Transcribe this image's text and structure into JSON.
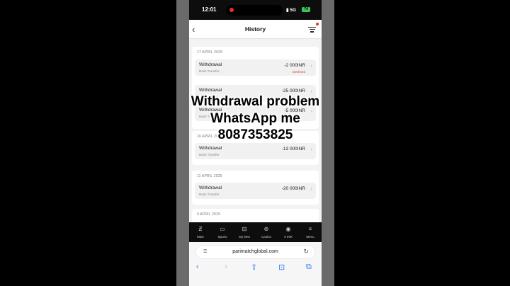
{
  "status_bar": {
    "time": "12:01",
    "network": "5G",
    "battery": "74"
  },
  "header": {
    "title": "History"
  },
  "groups": [
    {
      "date": "17 APRIL 2025",
      "transactions": [
        {
          "type": "Withdrawal",
          "method": "Bank Transfer",
          "amount": "-2 000INR",
          "status": "Declined"
        },
        {
          "type": "Withdrawal",
          "method": "",
          "amount": "-25 000INR",
          "status": ""
        },
        {
          "type": "Withdrawal",
          "method": "Bank Tr",
          "amount": "-5 000INR",
          "status": ""
        }
      ]
    },
    {
      "date": "16 APRIL 2025",
      "transactions": [
        {
          "type": "Withdrawal",
          "method": "Bank Transfer",
          "amount": "-13 000INR",
          "status": ""
        }
      ]
    },
    {
      "date": "11 APRIL 2025",
      "transactions": [
        {
          "type": "Withdrawal",
          "method": "Bank Transfer",
          "amount": "-20 000INR",
          "status": ""
        }
      ]
    },
    {
      "date": "9 APRIL 2025",
      "transactions": []
    }
  ],
  "tabbar": [
    {
      "label": "Main",
      "icon": "z-logo-icon"
    },
    {
      "label": "Sports",
      "icon": "scoreboard-icon"
    },
    {
      "label": "My bets",
      "icon": "ticket-icon"
    },
    {
      "label": "Casino",
      "icon": "chip-icon"
    },
    {
      "label": "0 INR",
      "icon": "user-icon"
    },
    {
      "label": "Menu",
      "icon": "menu-icon"
    }
  ],
  "browser": {
    "url": "parimatchglobal.com"
  },
  "overlay": {
    "line1": "Withdrawal problem",
    "line2": "WhatsApp me",
    "line3": "8087353825"
  },
  "colors": {
    "declined": "#dd3333",
    "tabbar_bg": "#0d0d0d",
    "safari_blue": "#2f7cf6"
  }
}
